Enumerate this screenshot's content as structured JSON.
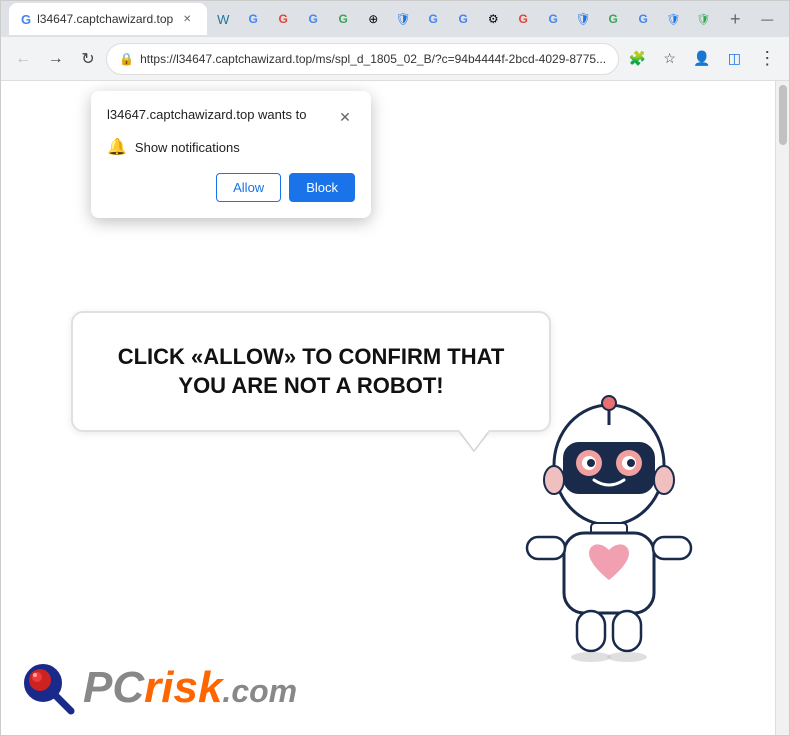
{
  "browser": {
    "title": "l34647.captchawizard.top",
    "tab_label": "l34647.captchawizard.top",
    "url": "https://l34647.captchawizard.top/ms/spl_d_1805_02_B/?c=94b4444f-2bcd-4029-8775...",
    "url_short": "https://l34647.captchawizard.top/ms/spl_d_1805_02_B/?c=94b4444f-2bcd-4029-8775...",
    "window_controls": {
      "minimize": "—",
      "maximize": "□",
      "close": "✕"
    }
  },
  "notification_popup": {
    "title": "l34647.captchawizard.top wants to",
    "notification_label": "Show notifications",
    "allow_label": "Allow",
    "block_label": "Block",
    "close_label": "✕"
  },
  "page": {
    "bubble_text": "CLICK «ALLOW» TO CONFIRM THAT YOU ARE NOT A ROBOT!",
    "logo_pc": "PC",
    "logo_risk": "risk",
    "logo_com": ".com"
  },
  "colors": {
    "accent_blue": "#1a73e8",
    "logo_orange": "#ff6600",
    "logo_gray": "#888888"
  }
}
